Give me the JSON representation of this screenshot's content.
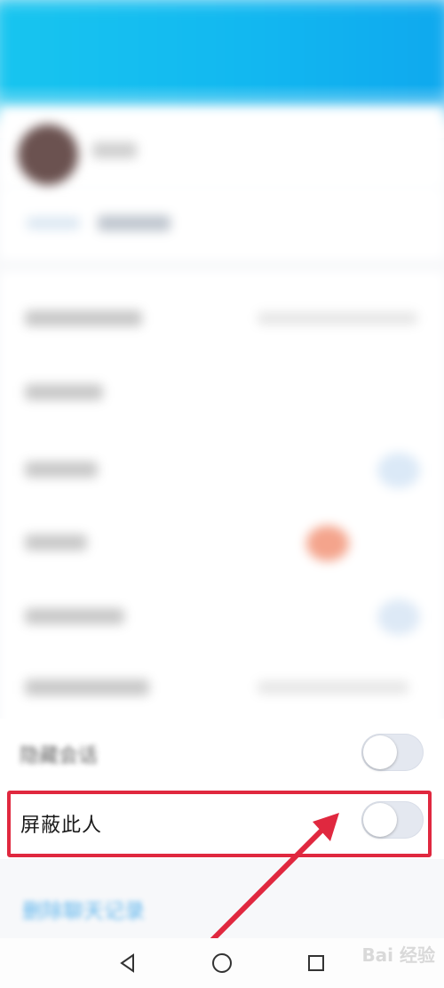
{
  "rows": {
    "block_label": "屏蔽此人",
    "hidden_label": "隐藏会话",
    "delete_label": "删除聊天记录"
  },
  "watermark": "Bai 经验",
  "colors": {
    "header": "#12b8f0",
    "highlight": "#e0283f",
    "arrow": "#e0283f",
    "link": "#2fa0e8"
  },
  "toggles": {
    "hidden_session": "off",
    "block_person": "off"
  },
  "nav_icons": [
    "back-icon",
    "home-icon",
    "recents-icon"
  ]
}
